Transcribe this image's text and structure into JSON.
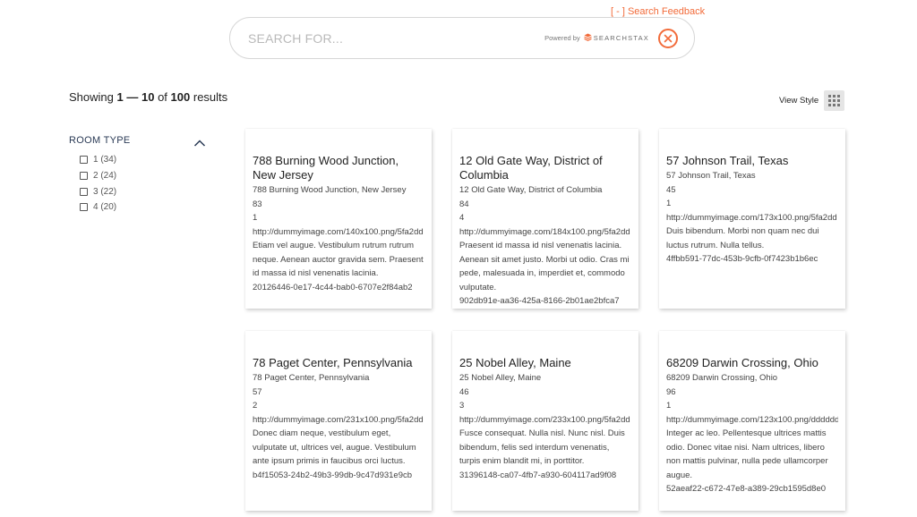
{
  "feedback_link": "[ - ] Search Feedback",
  "search": {
    "placeholder": "SEARCH FOR...",
    "value": "",
    "powered_by": "Powered by",
    "brand": "SEARCHSTAX"
  },
  "results_summary": {
    "prefix": "Showing",
    "start": "1",
    "dash": "—",
    "end": "10",
    "of": "of",
    "total": "100",
    "suffix": "results"
  },
  "view_style": {
    "label": "View Style"
  },
  "facets": {
    "title": "ROOM TYPE",
    "items": [
      {
        "label": "1",
        "count": "(34)"
      },
      {
        "label": "2",
        "count": "(24)"
      },
      {
        "label": "3",
        "count": "(22)"
      },
      {
        "label": "4",
        "count": "(20)"
      }
    ]
  },
  "results": [
    {
      "title": "788 Burning Wood Junction, New Jersey",
      "address": "788 Burning Wood Junction, New Jersey",
      "price": "83",
      "rooms": "1",
      "image_url": "http://dummyimage.com/140x100.png/5fa2dd",
      "description": "Etiam vel augue. Vestibulum rutrum rutrum neque. Aenean auctor gravida sem. Praesent id massa id nisl venenatis lacinia.",
      "id": "20126446-0e17-4c44-bab0-6707e2f84ab2"
    },
    {
      "title": "12 Old Gate Way, District of Columbia",
      "address": "12 Old Gate Way, District of Columbia",
      "price": "84",
      "rooms": "4",
      "image_url": "http://dummyimage.com/184x100.png/5fa2dd",
      "description": "Praesent id massa id nisl venenatis lacinia. Aenean sit amet justo. Morbi ut odio. Cras mi pede, malesuada in, imperdiet et, commodo vulputate.",
      "id": "902db91e-aa36-425a-8166-2b01ae2bfca7"
    },
    {
      "title": "57 Johnson Trail, Texas",
      "address": "57 Johnson Trail, Texas",
      "price": "45",
      "rooms": "1",
      "image_url": "http://dummyimage.com/173x100.png/5fa2dd",
      "description": "Duis bibendum. Morbi non quam nec dui luctus rutrum. Nulla tellus.",
      "id": "4ffbb591-77dc-453b-9cfb-0f7423b1b6ec"
    },
    {
      "title": "78 Paget Center, Pennsylvania",
      "address": "78 Paget Center, Pennsylvania",
      "price": "57",
      "rooms": "2",
      "image_url": "http://dummyimage.com/231x100.png/5fa2dd",
      "description": "Donec diam neque, vestibulum eget, vulputate ut, ultrices vel, augue. Vestibulum ante ipsum primis in faucibus orci luctus.",
      "id": "b4f15053-24b2-49b3-99db-9c47d931e9cb"
    },
    {
      "title": "25 Nobel Alley, Maine",
      "address": "25 Nobel Alley, Maine",
      "price": "46",
      "rooms": "3",
      "image_url": "http://dummyimage.com/233x100.png/5fa2dd",
      "description": "Fusce consequat. Nulla nisl. Nunc nisl. Duis bibendum, felis sed interdum venenatis, turpis enim blandit mi, in porttitor.",
      "id": "31396148-ca07-4fb7-a930-604117ad9f08"
    },
    {
      "title": "68209 Darwin Crossing, Ohio",
      "address": "68209 Darwin Crossing, Ohio",
      "price": "96",
      "rooms": "1",
      "image_url": "http://dummyimage.com/123x100.png/dddddd",
      "description": "Integer ac leo. Pellentesque ultrices mattis odio. Donec vitae nisi. Nam ultrices, libero non mattis pulvinar, nulla pede ullamcorper augue.",
      "id": "52aeaf22-c672-47e8-a389-29cb1595d8e0"
    }
  ]
}
